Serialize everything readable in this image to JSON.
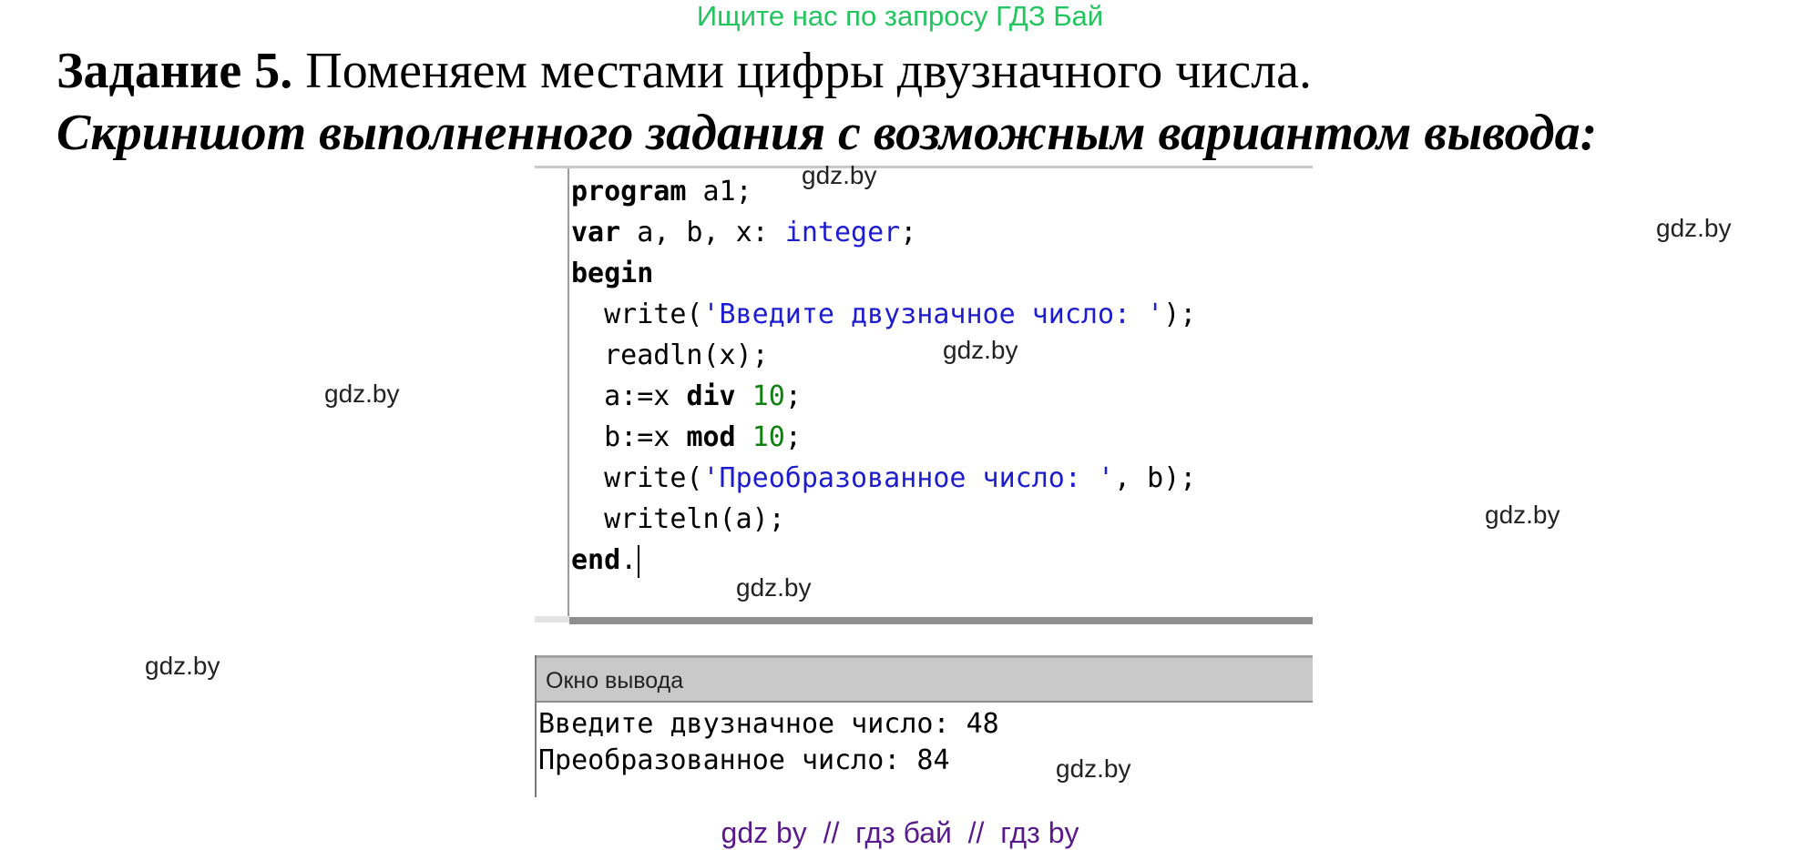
{
  "banner": {
    "text": "Ищите нас по запросу ГДЗ Бай"
  },
  "task": {
    "number_label": "Задание 5.",
    "description": " Поменяем местами цифры двузначного числа.",
    "subtitle": "Скриншот выполненного задания с возможным вариантом вывода:"
  },
  "editor": {
    "lines": [
      {
        "id": "l1",
        "parts": [
          {
            "t": "program",
            "c": "kw"
          },
          {
            "t": " a1;",
            "c": ""
          }
        ]
      },
      {
        "id": "l2",
        "parts": [
          {
            "t": "var",
            "c": "kw"
          },
          {
            "t": " a, b, x: ",
            "c": ""
          },
          {
            "t": "integer",
            "c": "ty"
          },
          {
            "t": ";",
            "c": ""
          }
        ]
      },
      {
        "id": "l3",
        "parts": [
          {
            "t": "begin",
            "c": "kw"
          }
        ]
      },
      {
        "id": "l4",
        "parts": [
          {
            "t": "  write(",
            "c": ""
          },
          {
            "t": "'Введите двузначное число: '",
            "c": "str"
          },
          {
            "t": ");",
            "c": ""
          }
        ]
      },
      {
        "id": "l5",
        "parts": [
          {
            "t": "  readln(x);",
            "c": ""
          }
        ]
      },
      {
        "id": "l6",
        "parts": [
          {
            "t": "  a:=x ",
            "c": ""
          },
          {
            "t": "div",
            "c": "kw"
          },
          {
            "t": " ",
            "c": ""
          },
          {
            "t": "10",
            "c": "num"
          },
          {
            "t": ";",
            "c": ""
          }
        ]
      },
      {
        "id": "l7",
        "parts": [
          {
            "t": "  b:=x ",
            "c": ""
          },
          {
            "t": "mod",
            "c": "kw"
          },
          {
            "t": " ",
            "c": ""
          },
          {
            "t": "10",
            "c": "num"
          },
          {
            "t": ";",
            "c": ""
          }
        ]
      },
      {
        "id": "l8",
        "parts": [
          {
            "t": "  write(",
            "c": ""
          },
          {
            "t": "'Преобразованное число: '",
            "c": "str"
          },
          {
            "t": ", b);",
            "c": ""
          }
        ]
      },
      {
        "id": "l9",
        "parts": [
          {
            "t": "  writeln(a);",
            "c": ""
          }
        ]
      },
      {
        "id": "l10",
        "parts": [
          {
            "t": "end",
            "c": "kw"
          },
          {
            "t": ".",
            "c": ""
          }
        ]
      }
    ]
  },
  "output": {
    "header": "Окно вывода",
    "lines": [
      "Введите двузначное число: 48",
      "Преобразованное число: 84"
    ]
  },
  "watermarks": [
    "gdz.by",
    "gdz.by",
    "gdz.by",
    "gdz.by",
    "gdz.by",
    "gdz.by",
    "gdz.by",
    "gdz.by"
  ],
  "footer": {
    "text": "gdz by  //  гдз бай  //  гдз by"
  }
}
